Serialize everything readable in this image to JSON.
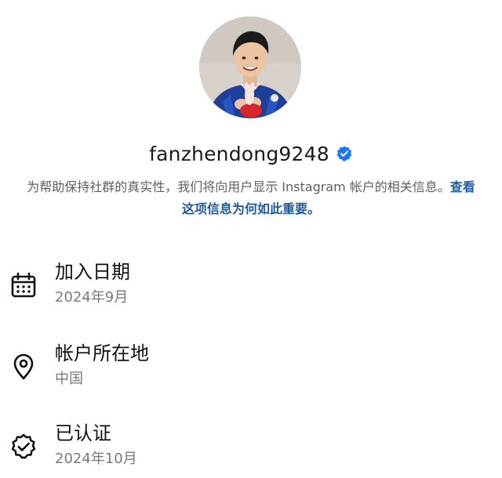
{
  "profile": {
    "username": "fanzhendong9248",
    "verified_icon": "verified-badge-icon",
    "accent_color": "#1877f2"
  },
  "info": {
    "text": "为帮助保持社群的真实性，我们将向用户显示 Instagram 帐户的相关信息。",
    "link": "查看这项信息为何如此重要。"
  },
  "details": [
    {
      "icon": "calendar-icon",
      "title": "加入日期",
      "value": "2024年9月"
    },
    {
      "icon": "location-pin-icon",
      "title": "帐户所在地",
      "value": "中国"
    },
    {
      "icon": "verified-seal-icon",
      "title": "已认证",
      "value": "2024年10月"
    }
  ]
}
